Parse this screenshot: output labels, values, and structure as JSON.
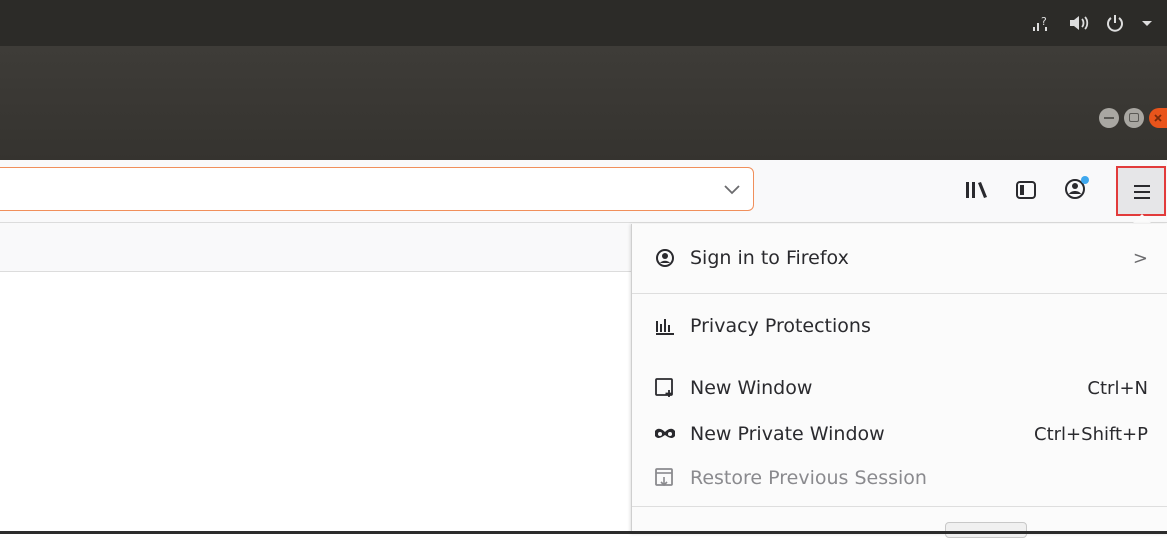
{
  "topbar": {
    "icons": [
      "network-icon",
      "volume-icon",
      "power-icon",
      "dropdown-arrow-icon"
    ]
  },
  "window_controls": [
    "minimize-icon",
    "maximize-icon",
    "close-icon"
  ],
  "toolbar": {
    "icons": [
      "library-icon",
      "sidebar-icon",
      "account-icon",
      "hamburger-menu-icon"
    ]
  },
  "menu": {
    "sign_in": {
      "label": "Sign in to Firefox",
      "chevron": ">"
    },
    "privacy": {
      "label": "Privacy Protections"
    },
    "new_window": {
      "label": "New Window",
      "shortcut": "Ctrl+N"
    },
    "new_private_window": {
      "label": "New Private Window",
      "shortcut": "Ctrl+Shift+P"
    },
    "restore_session": {
      "label": "Restore Previous Session"
    }
  },
  "colors": {
    "accent_close": "#e9541b",
    "url_focus": "#f08f5b",
    "highlight_box": "#e23b3b",
    "badge": "#3fa8ee"
  }
}
